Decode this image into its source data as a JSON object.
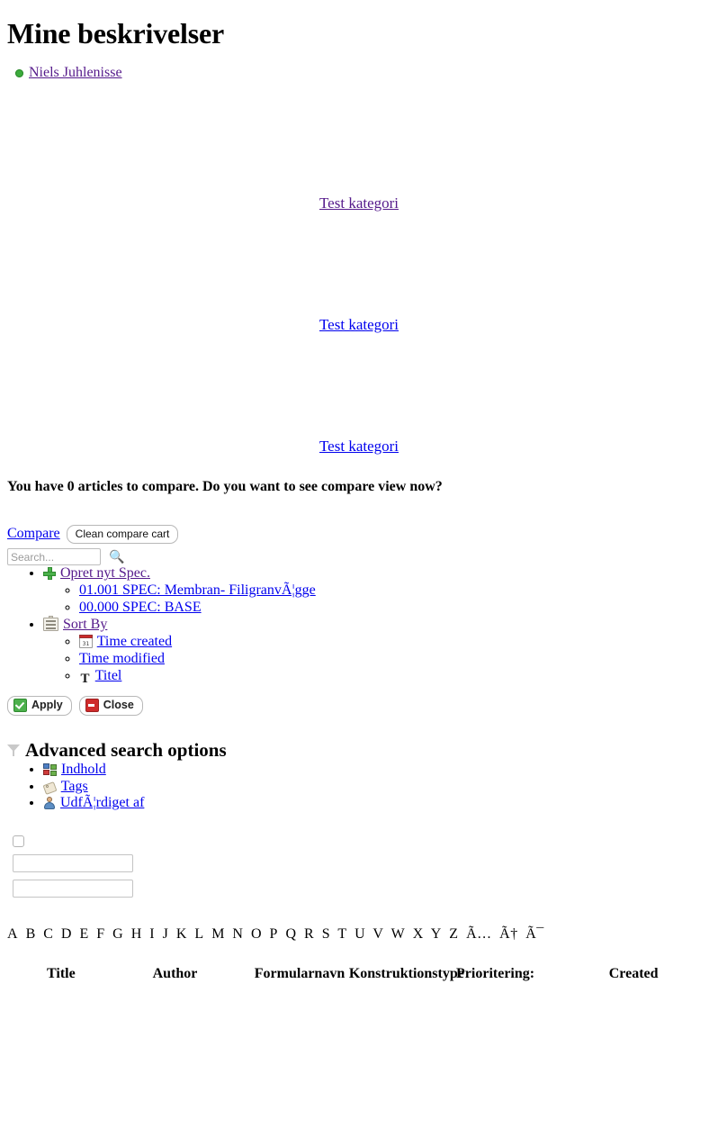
{
  "page": {
    "title": "Mine beskrivelser"
  },
  "user": {
    "name": "Niels Juhlenisse",
    "status_color": "#3cab3c",
    "status_icon": "green-dot-icon"
  },
  "categories": [
    {
      "label": "Test kategori",
      "state": "visited"
    },
    {
      "label": "Test kategori",
      "state": "link"
    },
    {
      "label": "Test kategori",
      "state": "link"
    }
  ],
  "compare": {
    "message": "You have 0 articles to compare. Do you want to see compare view now?",
    "link_label": "Compare",
    "clean_button_label": "Clean compare cart"
  },
  "search": {
    "value": "",
    "placeholder": "Search...",
    "icon": "binoculars-icon"
  },
  "menu": {
    "create": {
      "label": "Opret nyt Spec.",
      "icon": "plus-icon",
      "children": [
        {
          "label": "01.001 SPEC: Membran- FiligranvÃ¦gge"
        },
        {
          "label": "00.000 SPEC: BASE"
        }
      ]
    },
    "sort": {
      "label": "Sort By",
      "icon": "card-index-icon",
      "children": [
        {
          "label": "Time created",
          "icon": "calendar-icon"
        },
        {
          "label": "Time modified",
          "icon": ""
        },
        {
          "label": "Titel",
          "icon": "text-t-icon"
        }
      ]
    }
  },
  "actions": {
    "apply_label": "Apply",
    "apply_icon": "green-check-icon",
    "close_label": "Close",
    "close_icon": "red-minus-icon"
  },
  "advanced": {
    "title": "Advanced search options",
    "icon": "funnel-icon",
    "options": [
      {
        "label": "Indhold",
        "icon": "blocks-icon"
      },
      {
        "label": "Tags",
        "icon": "tag-icon"
      },
      {
        "label": "UdfÃ¦rdiget af",
        "icon": "person-icon"
      }
    ],
    "checkbox_checked": false,
    "field_one_value": "",
    "field_two_value": ""
  },
  "alphabet": [
    "A",
    "B",
    "C",
    "D",
    "E",
    "F",
    "G",
    "H",
    "I",
    "J",
    "K",
    "L",
    "M",
    "N",
    "O",
    "P",
    "Q",
    "R",
    "S",
    "T",
    "U",
    "V",
    "W",
    "X",
    "Y",
    "Z",
    "Ã…",
    "Ã†",
    "Ã¯"
  ],
  "table": {
    "headers": [
      "Title",
      "Author",
      "Formularnavn",
      "Konstruktionstype",
      "Prioritering:",
      "Created"
    ],
    "rows": []
  },
  "colors": {
    "link": "#0000ee",
    "visited": "#551a8b",
    "text": "#000000",
    "background": "#ffffff"
  }
}
